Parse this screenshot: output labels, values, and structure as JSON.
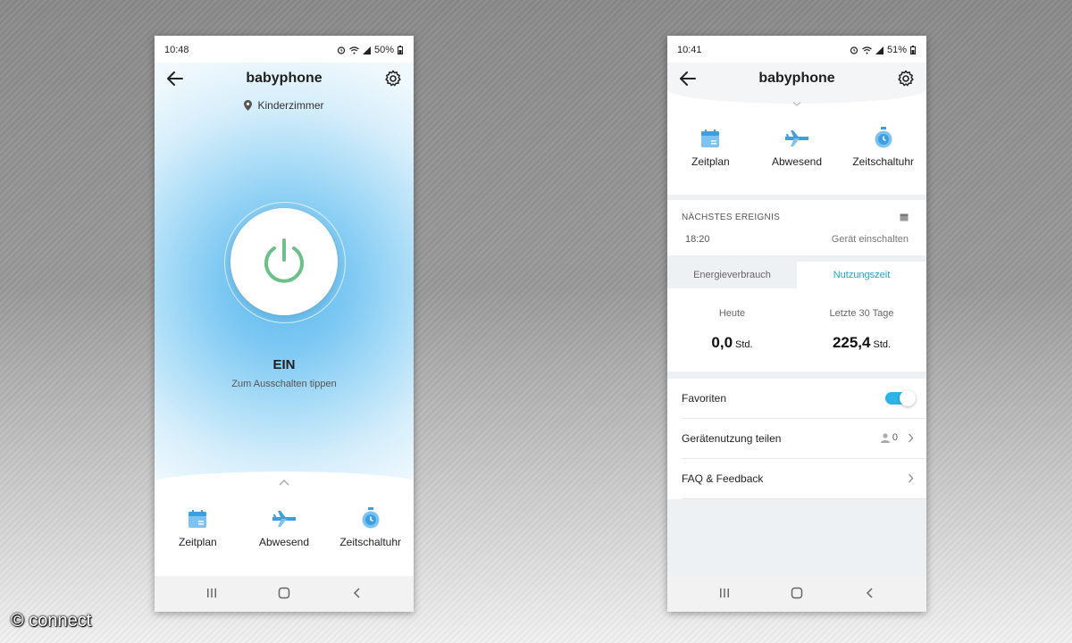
{
  "left_phone": {
    "status": {
      "time": "10:48",
      "battery": "50%"
    },
    "title": "babyphone",
    "location": "Kinderzimmer",
    "power_state": "EIN",
    "power_hint": "Zum Ausschalten tippen",
    "shortcuts": [
      {
        "label": "Zeitplan",
        "icon": "calendar-icon"
      },
      {
        "label": "Abwesend",
        "icon": "airplane-icon"
      },
      {
        "label": "Zeitschaltuhr",
        "icon": "timer-icon"
      }
    ]
  },
  "right_phone": {
    "status": {
      "time": "10:41",
      "battery": "51%"
    },
    "title": "babyphone",
    "shortcuts": [
      {
        "label": "Zeitplan",
        "icon": "calendar-icon"
      },
      {
        "label": "Abwesend",
        "icon": "airplane-icon"
      },
      {
        "label": "Zeitschaltuhr",
        "icon": "timer-icon"
      }
    ],
    "next_event": {
      "heading": "NÄCHSTES EREIGNIS",
      "time": "18:20",
      "action": "Gerät einschalten"
    },
    "tabs": [
      {
        "label": "Energieverbrauch",
        "active": false
      },
      {
        "label": "Nutzungszeit",
        "active": true
      }
    ],
    "stats": [
      {
        "label": "Heute",
        "value": "0,0",
        "unit": "Std."
      },
      {
        "label": "Letzte 30 Tage",
        "value": "225,4",
        "unit": "Std."
      }
    ],
    "rows": {
      "favorites": {
        "label": "Favoriten",
        "enabled": true
      },
      "share": {
        "label": "Gerätenutzung teilen",
        "count": "0"
      },
      "faq": {
        "label": "FAQ & Feedback"
      }
    }
  },
  "watermark": "© connect",
  "colors": {
    "accent": "#2bb5e6",
    "power_green": "#6cc08a",
    "icon_blue": "#3d9fe0"
  }
}
